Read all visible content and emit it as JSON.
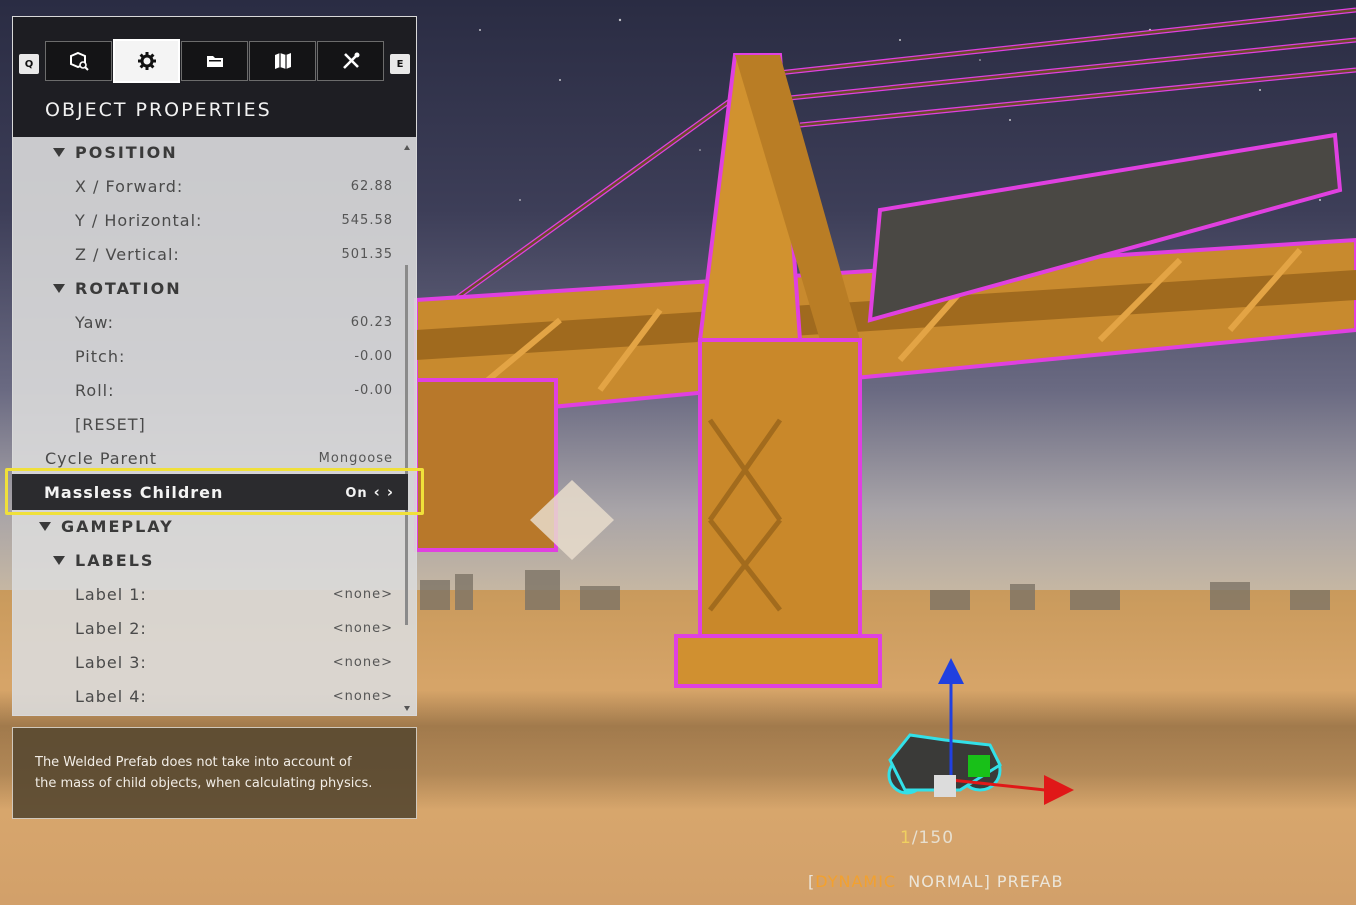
{
  "panel": {
    "hotkeys": {
      "left": "Q",
      "right": "E"
    },
    "tabs": [
      {
        "name": "object-browser",
        "icon": "cube-search-icon"
      },
      {
        "name": "object-properties",
        "icon": "gear-icon",
        "active": true
      },
      {
        "name": "folder",
        "icon": "folder-icon"
      },
      {
        "name": "map",
        "icon": "map-icon"
      },
      {
        "name": "tools",
        "icon": "tools-icon"
      }
    ],
    "title": "OBJECT PROPERTIES",
    "rows": {
      "position": "POSITION",
      "x_label": "X / Forward:",
      "x_value": "62.88",
      "y_label": "Y / Horizontal:",
      "y_value": "545.58",
      "z_label": "Z / Vertical:",
      "z_value": "501.35",
      "rotation": "ROTATION",
      "yaw_label": "Yaw:",
      "yaw_value": "60.23",
      "pitch_label": "Pitch:",
      "pitch_value": "-0.00",
      "roll_label": "Roll:",
      "roll_value": "-0.00",
      "reset": "[RESET]",
      "cycle_label": "Cycle Parent",
      "cycle_value": "Mongoose",
      "massless_label": "Massless Children",
      "massless_value": "On",
      "gameplay": "GAMEPLAY",
      "labels": "LABELS",
      "label1": "Label 1:",
      "label1_value": "<none>",
      "label2": "Label 2:",
      "label2_value": "<none>",
      "label3": "Label 3:",
      "label3_value": "<none>",
      "label4": "Label 4:",
      "label4_value": "<none>"
    }
  },
  "description": {
    "line1": "The Welded Prefab does not take into account of",
    "line2": "the mass of child objects, when calculating physics."
  },
  "hud": {
    "counter_current": "1",
    "counter_total": "/150",
    "mode_open": "[",
    "mode_dynamic": "DYNAMIC",
    "mode_rest": "  NORMAL] PREFAB"
  },
  "colors": {
    "selection_outline": "#e040e0",
    "highlight_border": "#f0e03a",
    "gizmo_z": "#2040e0",
    "gizmo_x": "#e01818",
    "gizmo_y": "#18c018"
  }
}
